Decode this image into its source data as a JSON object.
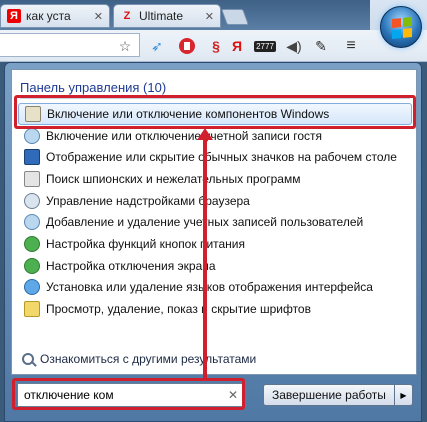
{
  "browser": {
    "tabs": [
      {
        "label": "как уста",
        "favicon": "Я"
      },
      {
        "label": "Ultimate",
        "favicon": "Z"
      }
    ],
    "toolbar_icons": [
      "star-icon",
      "bird-icon",
      "stop-icon",
      "translate-icon",
      "yandex-icon",
      "speaker-icon",
      "evernote-icon",
      "menu-icon"
    ],
    "badge_text": "2777",
    "translate_text": "Я"
  },
  "start_menu": {
    "group_title": "Панель управления (10)",
    "items": [
      {
        "label": "Включение или отключение компонентов Windows",
        "icon": "components-icon"
      },
      {
        "label": "Включение или отключение учетной записи гостя",
        "icon": "users-icon"
      },
      {
        "label": "Отображение или скрытие обычных значков на рабочем столе",
        "icon": "desktop-icon"
      },
      {
        "label": "Поиск шпионских и нежелательных программ",
        "icon": "defender-icon"
      },
      {
        "label": "Управление надстройками браузера",
        "icon": "gear-icon"
      },
      {
        "label": "Добавление и удаление учетных записей пользователей",
        "icon": "users-icon"
      },
      {
        "label": "Настройка функций кнопок питания",
        "icon": "power-icon"
      },
      {
        "label": "Настройка отключения экрана",
        "icon": "power-icon"
      },
      {
        "label": "Установка или удаление языков отображения интерфейса",
        "icon": "globe-icon"
      },
      {
        "label": "Просмотр, удаление, показ и скрытие шрифтов",
        "icon": "fonts-icon"
      }
    ],
    "more_results": "Ознакомиться с другими результатами",
    "search": {
      "value": "отключение ком",
      "clear": "✕"
    },
    "shutdown_label": "Завершение работы",
    "shutdown_arrow": "▶"
  },
  "colors": {
    "annotation": "#d0202e",
    "group_title": "#1f3a93"
  }
}
